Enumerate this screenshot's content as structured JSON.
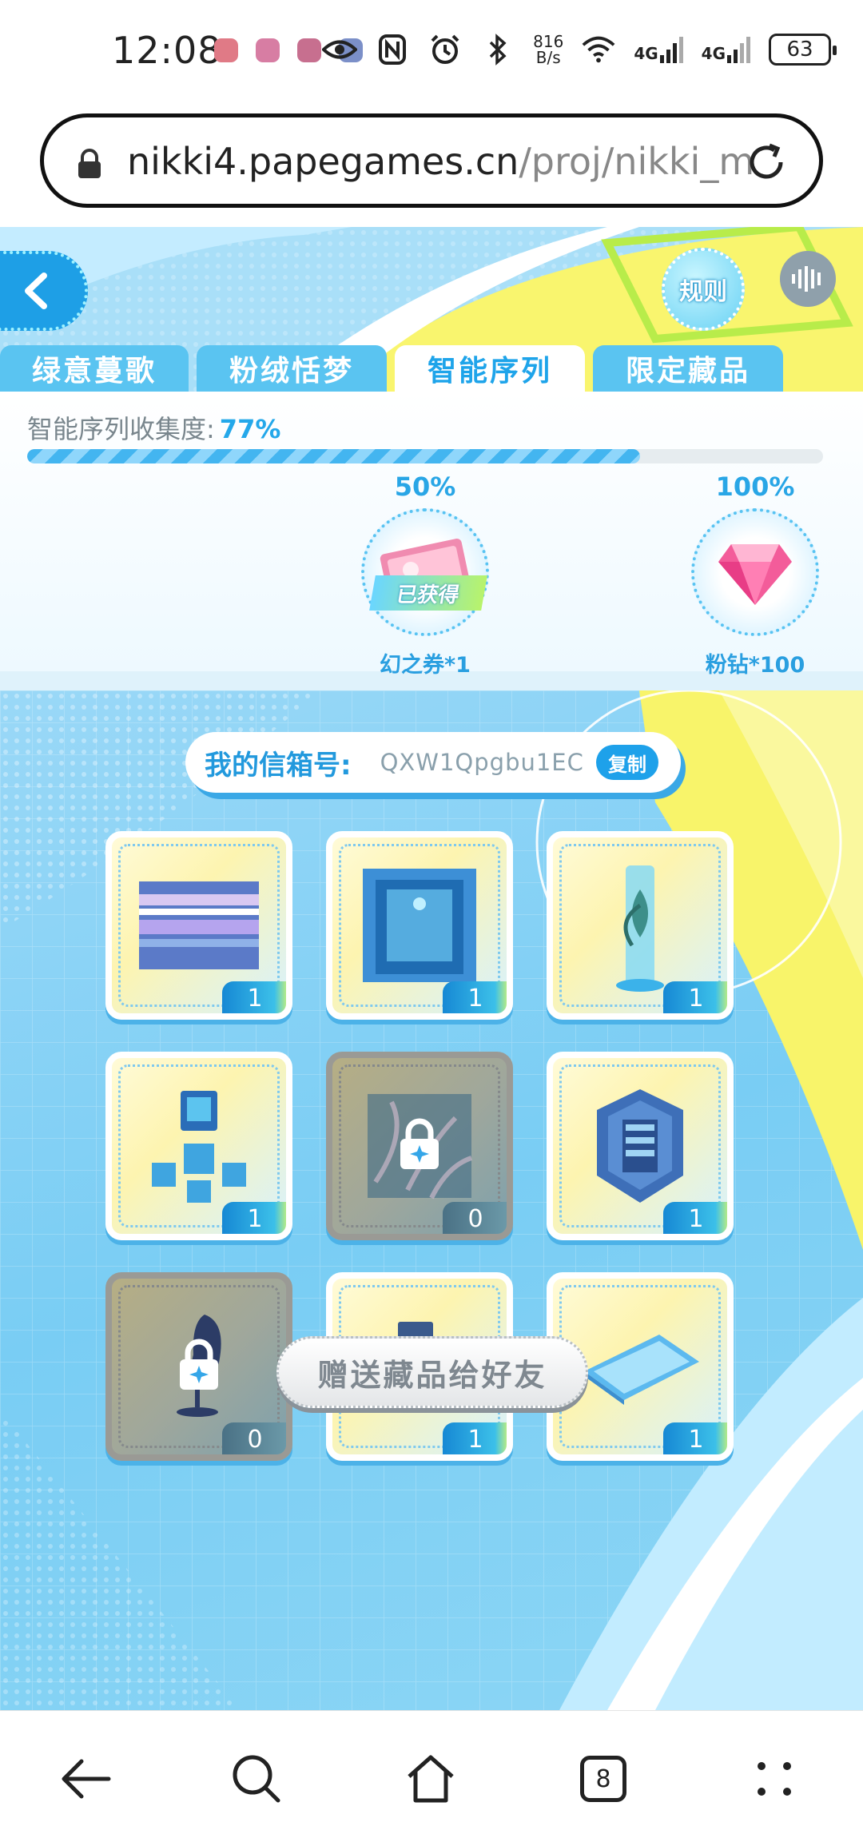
{
  "status_bar": {
    "time": "12:08",
    "net_speed_value": "816",
    "net_speed_unit": "B/s",
    "signal1": "4G",
    "signal2": "4G",
    "battery": "63"
  },
  "browser": {
    "url_host": "nikki4.papegames.cn",
    "url_path": "/proj/nikki_m",
    "tab_count": "8"
  },
  "header": {
    "rule_label": "规则"
  },
  "tabs": [
    {
      "label": "绿意蔓歌",
      "active": false
    },
    {
      "label": "粉绒恬梦",
      "active": false
    },
    {
      "label": "智能序列",
      "active": true
    },
    {
      "label": "限定藏品",
      "active": false
    }
  ],
  "progress": {
    "label": "智能序列收集度:",
    "value_text": "77%",
    "value": 0.77
  },
  "milestones": [
    {
      "percent": "50%",
      "reward": "幻之券*1",
      "status": "已获得",
      "position": 0.5
    },
    {
      "percent": "100%",
      "reward": "粉钻*100",
      "status": "",
      "position": 1.0
    }
  ],
  "mailbox": {
    "label": "我的信箱号:",
    "value": "QXW1Qpgbu1EC",
    "copy_label": "复制"
  },
  "items": [
    {
      "icon": "stripe-panel-icon",
      "count": "1",
      "locked": false
    },
    {
      "icon": "tech-door-icon",
      "count": "1",
      "locked": false
    },
    {
      "icon": "plant-tube-icon",
      "count": "1",
      "locked": false
    },
    {
      "icon": "furniture-set-icon",
      "count": "1",
      "locked": false
    },
    {
      "icon": "tentacle-wall-icon",
      "count": "0",
      "locked": true
    },
    {
      "icon": "hex-shield-icon",
      "count": "1",
      "locked": false
    },
    {
      "icon": "gaming-chair-icon",
      "count": "0",
      "locked": true
    },
    {
      "icon": "desk-console-icon",
      "count": "1",
      "locked": false
    },
    {
      "icon": "glass-tablet-icon",
      "count": "1",
      "locked": false
    }
  ],
  "gift_button": "赠送藏品给好友",
  "colors": {
    "accent": "#1ea4ea",
    "tab_inactive": "#5ac4f1",
    "panel_bg": "#79cdf4",
    "yellow_accent": "#f8f46a"
  }
}
